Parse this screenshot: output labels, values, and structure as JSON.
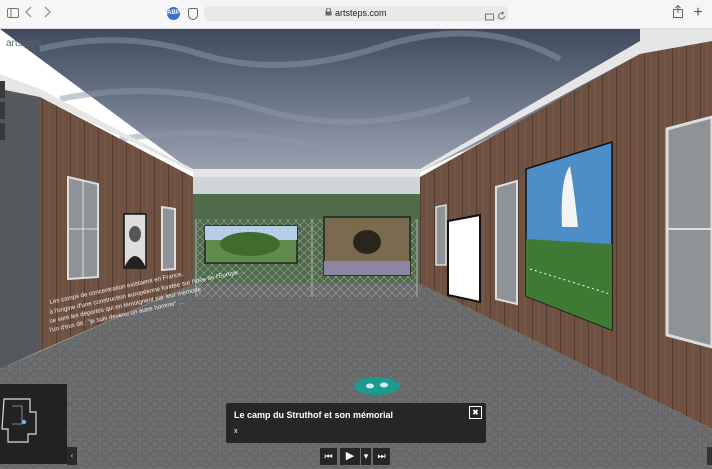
{
  "browser": {
    "url": "artsteps.com",
    "extension_badge": "ABP"
  },
  "scene": {
    "logo": "artsteps",
    "wall_text": [
      "Les camps de concentration existaient en France,",
      "à l'origine d'une construction européenne fondée sur l'idée de l'Europe...",
      "ce sont les déportés qui en témoignent par leur mémoire",
      "l'un d'eux dit : \"je suis devenu un autre homme\" ..."
    ]
  },
  "caption": {
    "title": "Le camp du Struthof et son mémorial",
    "subtitle": "x",
    "close": "✖"
  },
  "controls": {
    "prev": "⏮",
    "play": "▶",
    "menu": "▾",
    "next": "⏭"
  },
  "minimap": {
    "toggle": "‹"
  },
  "colors": {
    "accent": "#1d9a8e",
    "panel": "#262626",
    "sky": "#4e5b70"
  },
  "icons": [
    "sidebar-icon",
    "back-icon",
    "forward-icon",
    "shield-icon",
    "lock-icon",
    "translate-icon",
    "reload-icon",
    "share-icon",
    "new-tab-icon",
    "footprint-icon"
  ]
}
